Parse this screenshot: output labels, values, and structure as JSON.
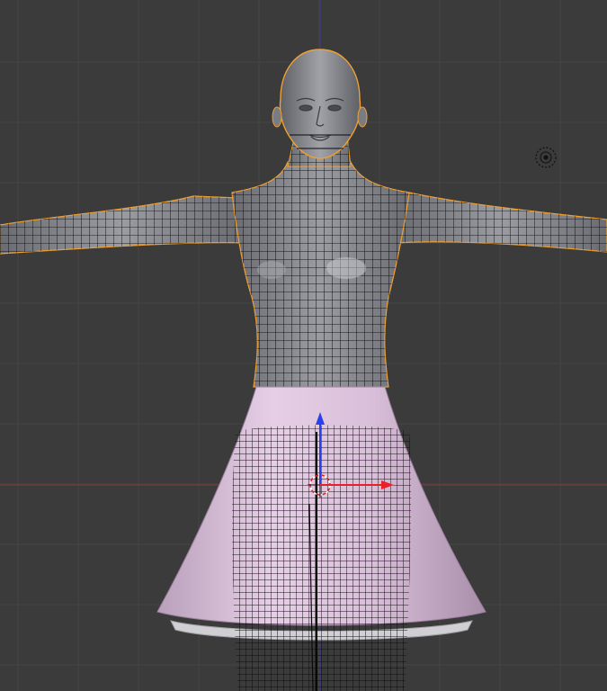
{
  "viewport": {
    "mode": "3D Viewport",
    "background": "#3b3b3b",
    "grid_color": "#444444",
    "axis_x_color": "#8a3a3a",
    "axis_z_color": "#3a3a8a"
  },
  "object": {
    "type": "mesh-character",
    "selected": true,
    "outline_color": "#f0a030",
    "body_color": "#8a8c92",
    "wire_color": "#000000",
    "skirt_color": "#d8bcd8",
    "skirt_hem_color": "#c8c8cc"
  },
  "gizmo": {
    "icon": "transform-gizmo-icon",
    "x_color": "#e8202a",
    "z_color": "#2a40e8",
    "origin_icon": "3d-cursor-icon"
  },
  "light": {
    "icon": "lamp-icon"
  }
}
